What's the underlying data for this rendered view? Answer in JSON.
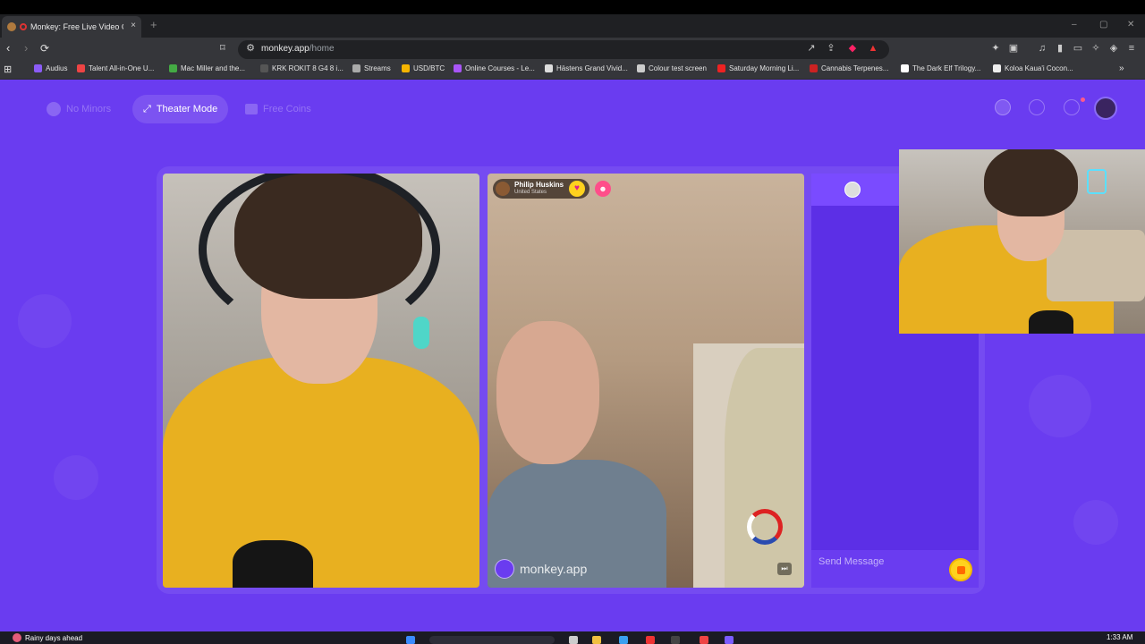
{
  "browser": {
    "tab_title": "Monkey: Free Live Video Chat",
    "tab_close": "×",
    "new_tab": "+",
    "url_domain": "monkey.app",
    "url_path": "/home",
    "window_controls": [
      "–",
      "▢",
      "✕"
    ],
    "nav": {
      "back": "‹",
      "forward": "›",
      "reload": "⟳",
      "bookmark": "⌑"
    }
  },
  "bookmarks": [
    {
      "label": "Audius",
      "color": "#8b5cf6"
    },
    {
      "label": "Talent All-in-One U...",
      "color": "#e44"
    },
    {
      "label": "Mac Miller and the...",
      "color": "#4a4"
    },
    {
      "label": "KRK ROKIT 8 G4 8 i...",
      "color": "#555"
    },
    {
      "label": "Streams",
      "color": "#aaa"
    },
    {
      "label": "USD/BTC",
      "color": "#f5b400"
    },
    {
      "label": "Online Courses - Le...",
      "color": "#a855f7"
    },
    {
      "label": "Hästens Grand Vivid...",
      "color": "#ddd"
    },
    {
      "label": "Colour test screen",
      "color": "#ccc"
    },
    {
      "label": "Saturday Morning Li...",
      "color": "#e22"
    },
    {
      "label": "Cannabis Terpenes...",
      "color": "#c22"
    },
    {
      "label": "The Dark Elf Trilogy...",
      "color": "#fff"
    },
    {
      "label": "Koloa Kaua'i Cocon...",
      "color": "#eee"
    }
  ],
  "app": {
    "topbar": {
      "no_minors": "No Minors",
      "theater_mode": "Theater Mode",
      "free_coins": "Free Coins"
    },
    "match": {
      "name": "Philip Huskins",
      "country": "United States",
      "heart_icon": "♥",
      "report_icon": "☻"
    },
    "watermark": "monkey.app",
    "skip_icon": "⏭",
    "chat": {
      "send_placeholder": "Send Message"
    }
  },
  "taskbar": {
    "weather": "Rainy days ahead",
    "clock": "1:33 AM"
  },
  "colors": {
    "accent": "#6a3cf0",
    "gift": "#ffd21e"
  }
}
